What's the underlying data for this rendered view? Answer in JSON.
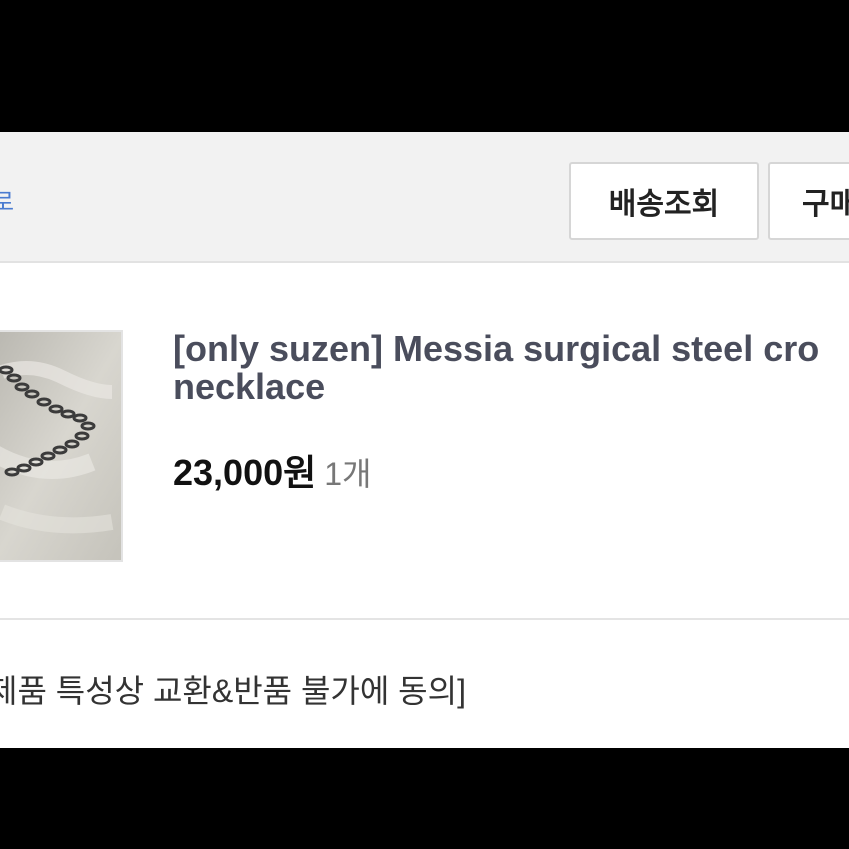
{
  "toolbar": {
    "left_link": "로",
    "delivery_label": "배송조회",
    "purchase_label": "구매"
  },
  "product": {
    "title_line1": "[only suzen] Messia surgical steel cro",
    "title_line2": "necklace",
    "price": "23,000원",
    "quantity": "1개",
    "image_icon": "necklace-photo"
  },
  "notice": {
    "agreement": "제품 특성상 교환&반품 불가에 동의]"
  },
  "colors": {
    "background": "#000000",
    "panel": "#ffffff",
    "toolbar": "#f2f2f2",
    "link": "#4a7bd0",
    "title": "#4a4d5c"
  }
}
